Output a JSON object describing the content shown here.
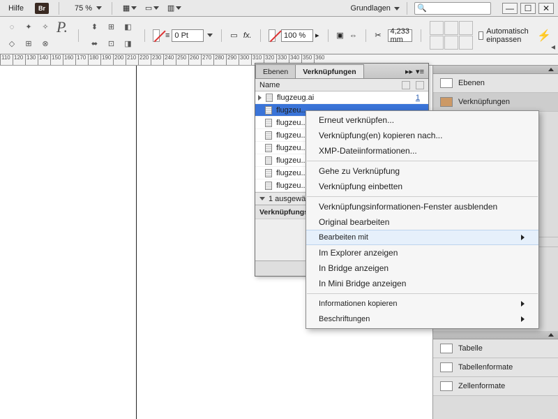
{
  "menubar": {
    "hilfe": "Hilfe",
    "br": "Br",
    "zoom": "75 %",
    "grundlagen": "Grundlagen"
  },
  "optbar": {
    "pt": "0 Pt",
    "pct": "100 %",
    "mm": "4,233 mm",
    "autofit": "Automatisch einpassen"
  },
  "ruler": {
    "start": 110,
    "step": 10,
    "count": 26
  },
  "rightpanel": {
    "ebenen": "Ebenen",
    "verkn": "Verknüpfungen",
    "tabelle": "Tabelle",
    "tabf": "Tabellenformate",
    "zellf": "Zellenformate"
  },
  "linkspanel": {
    "tab_ebenen": "Ebenen",
    "tab_verkn": "Verknüpfungen",
    "head_name": "Name",
    "items": [
      {
        "label": "flugzeug.ai",
        "page": "1"
      },
      {
        "label": "flugzeu...",
        "page": ""
      },
      {
        "label": "flugzeu...",
        "page": ""
      },
      {
        "label": "flugzeu...",
        "page": ""
      },
      {
        "label": "flugzeu...",
        "page": ""
      },
      {
        "label": "flugzeu...",
        "page": ""
      },
      {
        "label": "flugzeu...",
        "page": ""
      },
      {
        "label": "flugzeu...",
        "page": ""
      }
    ],
    "selstatus": "1 ausgewähl...",
    "infohead": "Verknüpfungs..."
  },
  "ctx": {
    "relink": "Erneut verknüpfen...",
    "copyto": "Verknüpfung(en) kopieren nach...",
    "xmp": "XMP-Dateiinformationen...",
    "goto": "Gehe zu Verknüpfung",
    "embed": "Verknüpfung einbetten",
    "hideinfo": "Verknüpfungsinformationen-Fenster ausblenden",
    "editorig": "Original bearbeiten",
    "editwith": "Bearbeiten mit",
    "explorer": "Im Explorer anzeigen",
    "bridge": "In Bridge anzeigen",
    "minibridge": "In Mini Bridge anzeigen",
    "copyinfo": "Informationen kopieren",
    "captions": "Beschriftungen"
  }
}
